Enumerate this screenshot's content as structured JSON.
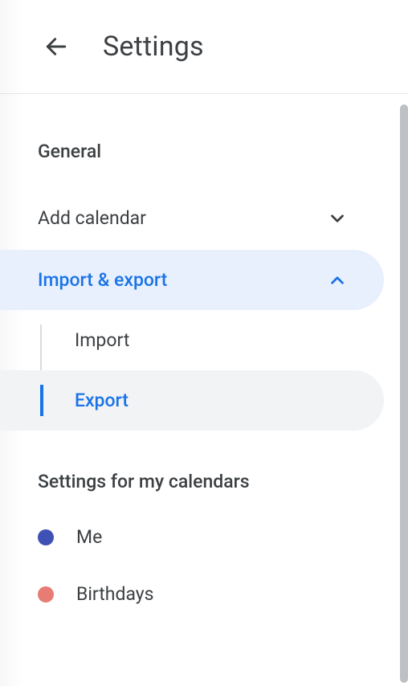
{
  "header": {
    "title": "Settings"
  },
  "nav": {
    "general": "General",
    "add_calendar": "Add calendar",
    "import_export": "Import & export",
    "sub": {
      "import": "Import",
      "export": "Export"
    }
  },
  "calendars_section": {
    "title": "Settings for my calendars",
    "items": [
      {
        "label": "Me",
        "color": "#3f51b5"
      },
      {
        "label": "Birthdays",
        "color": "#e67c73"
      }
    ]
  }
}
